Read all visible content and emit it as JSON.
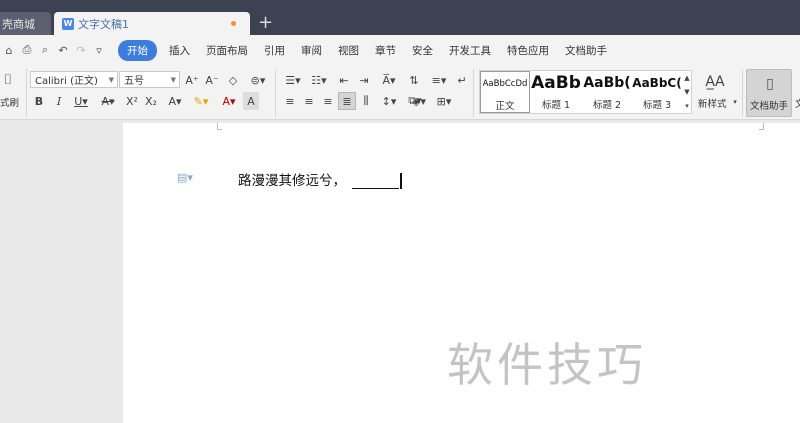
{
  "tabs": {
    "inactive_label": "壳商城",
    "active_label": "文字文稿1",
    "new_tab": "+"
  },
  "menu": {
    "items": [
      "开始",
      "插入",
      "页面布局",
      "引用",
      "审阅",
      "视图",
      "章节",
      "安全",
      "开发工具",
      "特色应用",
      "文档助手"
    ]
  },
  "ribbon": {
    "format_painter_label": "式刷",
    "font_name": "Calibri (正文)",
    "font_size": "五号",
    "styles": [
      {
        "sample": "AaBbCcDd",
        "label": "正文"
      },
      {
        "sample": "AaBb",
        "label": "标题 1"
      },
      {
        "sample": "AaBb(",
        "label": "标题 2"
      },
      {
        "sample": "AaBbC(",
        "label": "标题 3"
      }
    ],
    "new_style_label": "新样式",
    "doc_assistant_label": "文档助手",
    "cut_label": "文"
  },
  "document": {
    "text": "路漫漫其修远兮，"
  },
  "watermark": "软件技巧",
  "colors": {
    "accent": "#3d7ddc",
    "tabbar": "#3c4251",
    "unsaved_dot": "#f0922b"
  }
}
